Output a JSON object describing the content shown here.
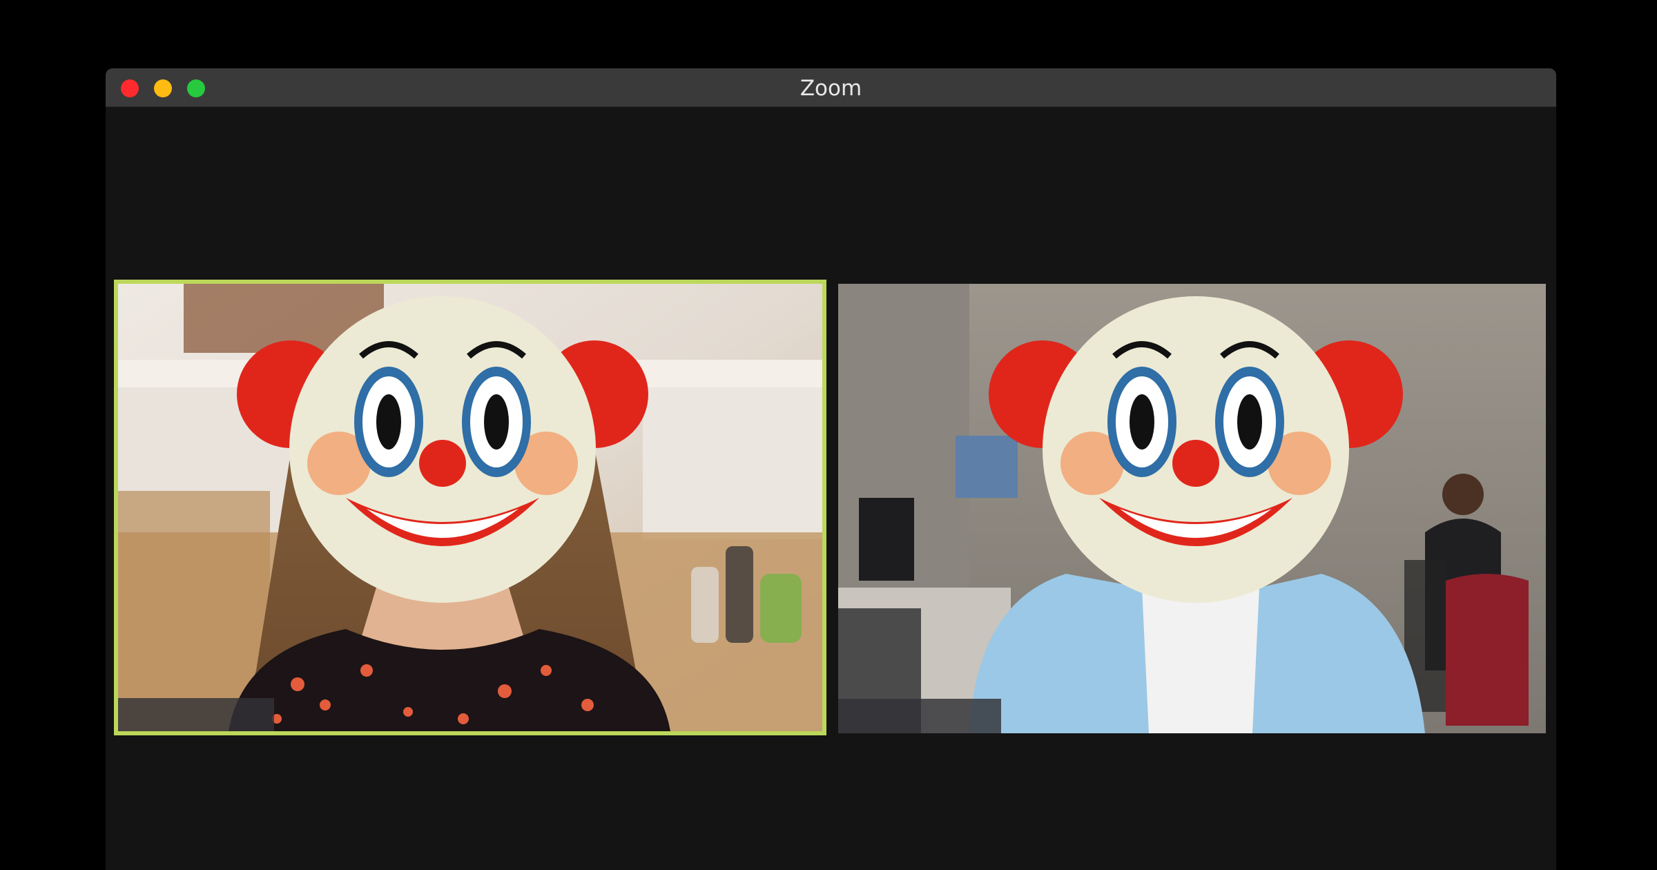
{
  "window": {
    "title": "Zoom",
    "controls": [
      "close",
      "minimize",
      "maximize"
    ]
  },
  "participants": [
    {
      "active_speaker": true,
      "name_label": "",
      "face_overlay": "clown-face-emoji"
    },
    {
      "active_speaker": false,
      "name_label": "",
      "face_overlay": "clown-face-emoji"
    }
  ],
  "colors": {
    "active_speaker_border": "#bcd85a",
    "window_background": "#141414",
    "titlebar": "#3a3a3a"
  }
}
